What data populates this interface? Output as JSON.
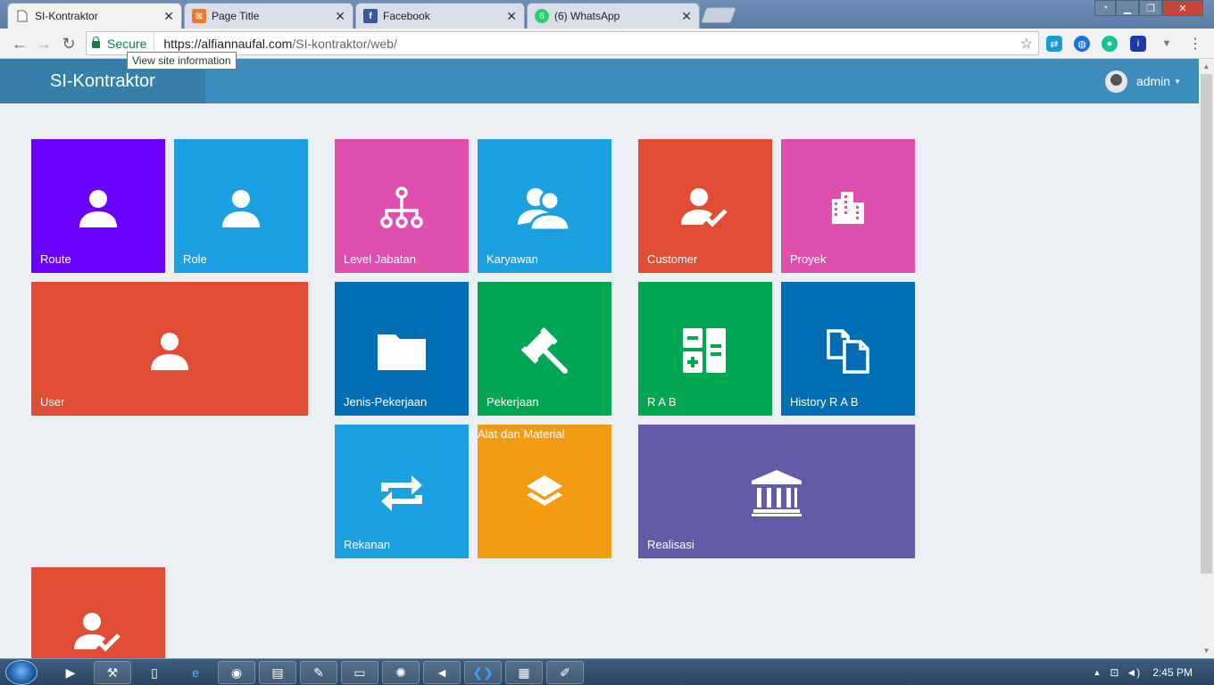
{
  "browser": {
    "tabs": [
      {
        "title": "SI-Kontraktor",
        "favicon": "page-icon",
        "active": true
      },
      {
        "title": "Page Title",
        "favicon": "xampp-icon",
        "active": false
      },
      {
        "title": "Facebook",
        "favicon": "facebook-icon",
        "active": false
      },
      {
        "title": "(6) WhatsApp",
        "favicon": "whatsapp-icon",
        "active": false
      }
    ],
    "secure_label": "Secure",
    "url_host": "https://alfiannaufal.com",
    "url_path": "/SI-kontraktor/web/",
    "tooltip": "View site information"
  },
  "app": {
    "brand": "SI-Kontraktor",
    "user": "admin"
  },
  "tiles": [
    {
      "label": "Route",
      "icon": "user-icon",
      "color": "#6a00ff"
    },
    {
      "label": "Role",
      "icon": "user-icon",
      "color": "#1ba1e2"
    },
    {
      "label": "User",
      "icon": "user-icon",
      "color": "#e04c34"
    },
    {
      "label": "Level Jabatan",
      "icon": "sitemap-icon",
      "color": "#df4fae"
    },
    {
      "label": "Karyawan",
      "icon": "users-icon",
      "color": "#1ba1e2"
    },
    {
      "label": "Jenis-Pekerjaan",
      "icon": "folder-icon",
      "color": "#006eb4"
    },
    {
      "label": "Pekerjaan",
      "icon": "gavel-icon",
      "color": "#00a651"
    },
    {
      "label": "Rekanan",
      "icon": "retweet-icon",
      "color": "#1ba1e2"
    },
    {
      "label": "Alat dan Material",
      "icon": "layers-icon",
      "color": "#f39c12"
    },
    {
      "label": "Customer",
      "icon": "user-check-icon",
      "color": "#e04c34"
    },
    {
      "label": "Proyek",
      "icon": "building-icon",
      "color": "#df4fae"
    },
    {
      "label": "R A B",
      "icon": "calculator-icon",
      "color": "#00a651"
    },
    {
      "label": "History R A B",
      "icon": "copy-icon",
      "color": "#006eb4"
    },
    {
      "label": "Realisasi",
      "icon": "bank-icon",
      "color": "#635ba8"
    },
    {
      "label": "",
      "icon": "user-check-icon",
      "color": "#e04c34"
    }
  ],
  "taskbar": {
    "clock": "2:45 PM"
  }
}
